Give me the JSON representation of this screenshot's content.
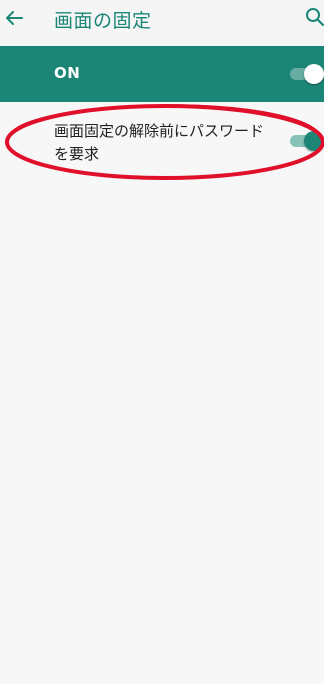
{
  "app_bar": {
    "title": "画面の固定",
    "back_icon": "arrow-left-icon",
    "search_icon": "search-icon"
  },
  "main_toggle": {
    "label": "ON",
    "checked": true
  },
  "settings": [
    {
      "label": "画面固定の解除前にパスワードを要求",
      "checked": true
    }
  ],
  "colors": {
    "accent": "#1c8676",
    "annotation": "#e0102a"
  }
}
